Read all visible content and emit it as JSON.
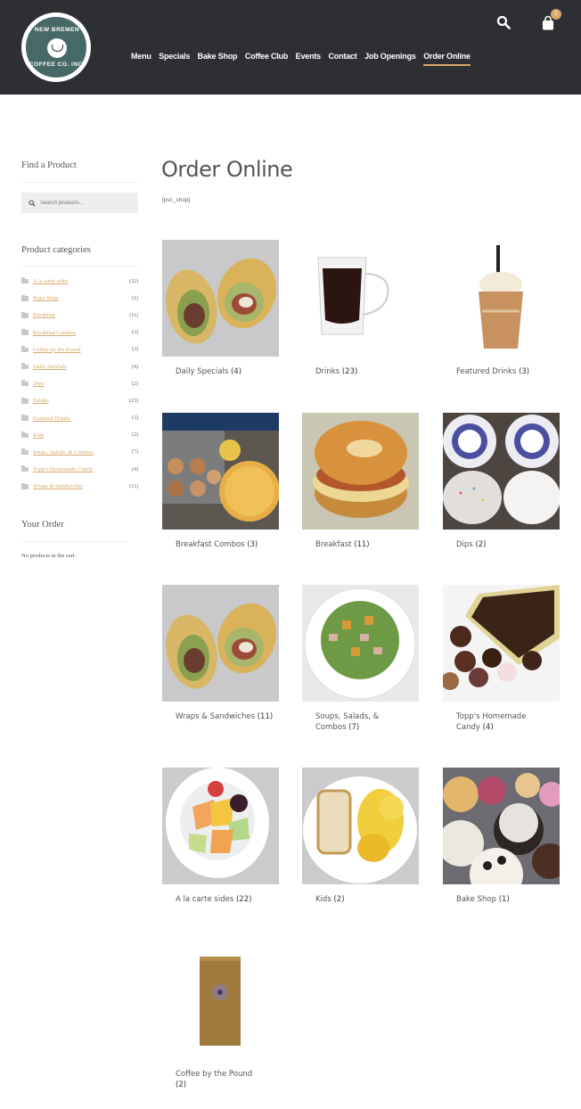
{
  "header": {
    "logo": {
      "top_text": "NEW BREMEN",
      "bottom_text": "COFFEE CO. INC."
    },
    "nav": [
      {
        "label": "Menu",
        "active": false
      },
      {
        "label": "Specials",
        "active": false
      },
      {
        "label": "Bake Shop",
        "active": false
      },
      {
        "label": "Coffee Club",
        "active": false
      },
      {
        "label": "Events",
        "active": false
      },
      {
        "label": "Contact",
        "active": false
      },
      {
        "label": "Job Openings",
        "active": false
      },
      {
        "label": "Order Online",
        "active": true
      }
    ],
    "icons": {
      "search": "search-icon",
      "cart": "shopping-bag-icon"
    },
    "cart_count": "0",
    "accent_color": "#d9a86a",
    "bg_color": "#2e2f33"
  },
  "sidebar": {
    "find_title": "Find a Product",
    "search_placeholder": "Search products...",
    "categories_title": "Product categories",
    "categories": [
      {
        "label": "A la carte sides",
        "count": "(22)"
      },
      {
        "label": "Bake Shop",
        "count": "(1)"
      },
      {
        "label": "Breakfast",
        "count": "(11)"
      },
      {
        "label": "Breakfast Combos",
        "count": "(3)"
      },
      {
        "label": "Coffee by the Pound",
        "count": "(2)"
      },
      {
        "label": "Daily Specials",
        "count": "(4)"
      },
      {
        "label": "Dips",
        "count": "(2)"
      },
      {
        "label": "Drinks",
        "count": "(23)"
      },
      {
        "label": "Featured Drinks",
        "count": "(3)"
      },
      {
        "label": "Kids",
        "count": "(2)"
      },
      {
        "label": "Soups, Salads, & Combos",
        "count": "(7)"
      },
      {
        "label": "Topp's Homemade Candy",
        "count": "(4)"
      },
      {
        "label": "Wraps & Sandwiches",
        "count": "(11)"
      }
    ],
    "order_title": "Your Order",
    "empty_cart": "No products in the cart."
  },
  "main": {
    "title": "Order Online",
    "shortcode": "[psc_shop]",
    "products": [
      {
        "name": "Daily Specials",
        "count": "(4)",
        "image": "wrap-sandwich"
      },
      {
        "name": "Drinks",
        "count": "(23)",
        "image": "coffee-cup"
      },
      {
        "name": "Featured Drinks",
        "count": "(3)",
        "image": "frappe"
      },
      {
        "name": "Breakfast Combos",
        "count": "(3)",
        "image": "quiche-muffins"
      },
      {
        "name": "Breakfast",
        "count": "(11)",
        "image": "bagel-sandwich"
      },
      {
        "name": "Dips",
        "count": "(2)",
        "image": "dip-tubs"
      },
      {
        "name": "Wraps & Sandwiches",
        "count": "(11)",
        "image": "wrap-sandwich"
      },
      {
        "name": "Soups, Salads, &",
        "name2": "Combos",
        "count": "(7)",
        "image": "salad"
      },
      {
        "name": "Topp's Homemade",
        "name2": "Candy",
        "count": "(4)",
        "image": "chocolates"
      },
      {
        "name": "A la carte sides",
        "count": "(22)",
        "image": "fruit-bowl"
      },
      {
        "name": "Kids",
        "count": "(2)",
        "image": "bread-chips"
      },
      {
        "name": "Bake Shop",
        "count": "(1)",
        "image": "cupcakes"
      },
      {
        "name": "Coffee by the Pound",
        "name2": "",
        "count": "(2)",
        "image": "coffee-bag"
      }
    ]
  }
}
